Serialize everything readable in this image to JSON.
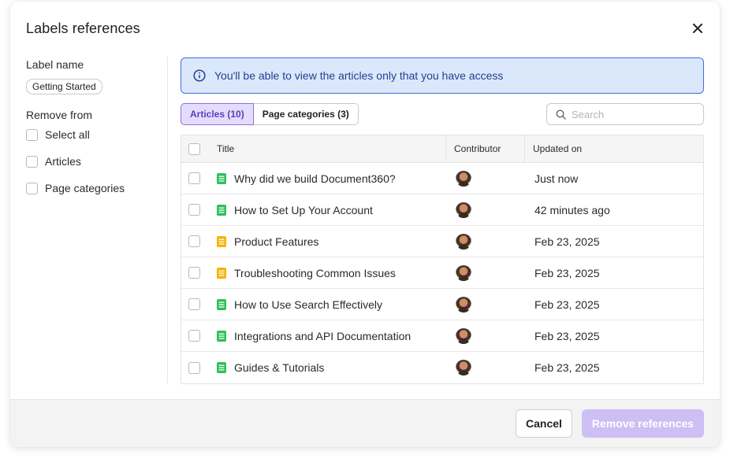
{
  "dialog": {
    "title": "Labels references",
    "close_icon": "close-icon"
  },
  "left_panel": {
    "label_name_heading": "Label name",
    "label_chip": "Getting Started",
    "remove_from_heading": "Remove from",
    "options": [
      {
        "label": "Select all",
        "checked": false
      },
      {
        "label": "Articles",
        "checked": false
      },
      {
        "label": "Page categories",
        "checked": false
      }
    ]
  },
  "info_banner": {
    "icon": "info-icon",
    "text": "You'll be able to view the articles only that you have access"
  },
  "tabs": [
    {
      "label": "Articles (10)",
      "active": true
    },
    {
      "label": "Page categories (3)",
      "active": false
    }
  ],
  "search": {
    "placeholder": "Search",
    "icon": "search-icon"
  },
  "table": {
    "headers": {
      "title": "Title",
      "contributor": "Contributor",
      "updated": "Updated on"
    },
    "rows": [
      {
        "title": "Why did we build Document360?",
        "status": "published",
        "updated": "Just now"
      },
      {
        "title": "How to Set Up Your Account",
        "status": "published",
        "updated": "42 minutes ago"
      },
      {
        "title": "Product Features",
        "status": "draft",
        "updated": "Feb 23, 2025"
      },
      {
        "title": "Troubleshooting Common Issues",
        "status": "draft",
        "updated": "Feb 23, 2025"
      },
      {
        "title": "How to Use Search Effectively",
        "status": "published",
        "updated": "Feb 23, 2025"
      },
      {
        "title": "Integrations and API Documentation",
        "status": "published",
        "updated": "Feb 23, 2025"
      },
      {
        "title": "Guides & Tutorials",
        "status": "published",
        "updated": "Feb 23, 2025"
      }
    ]
  },
  "footer": {
    "cancel_label": "Cancel",
    "remove_label": "Remove references"
  },
  "colors": {
    "accent": "#8c6fe3",
    "published_icon": "#2fbf5b",
    "draft_icon": "#f5b400",
    "banner_bg": "#dbe8fb",
    "banner_border": "#3c6fd6",
    "remove_button_disabled": "#cdbff4"
  }
}
